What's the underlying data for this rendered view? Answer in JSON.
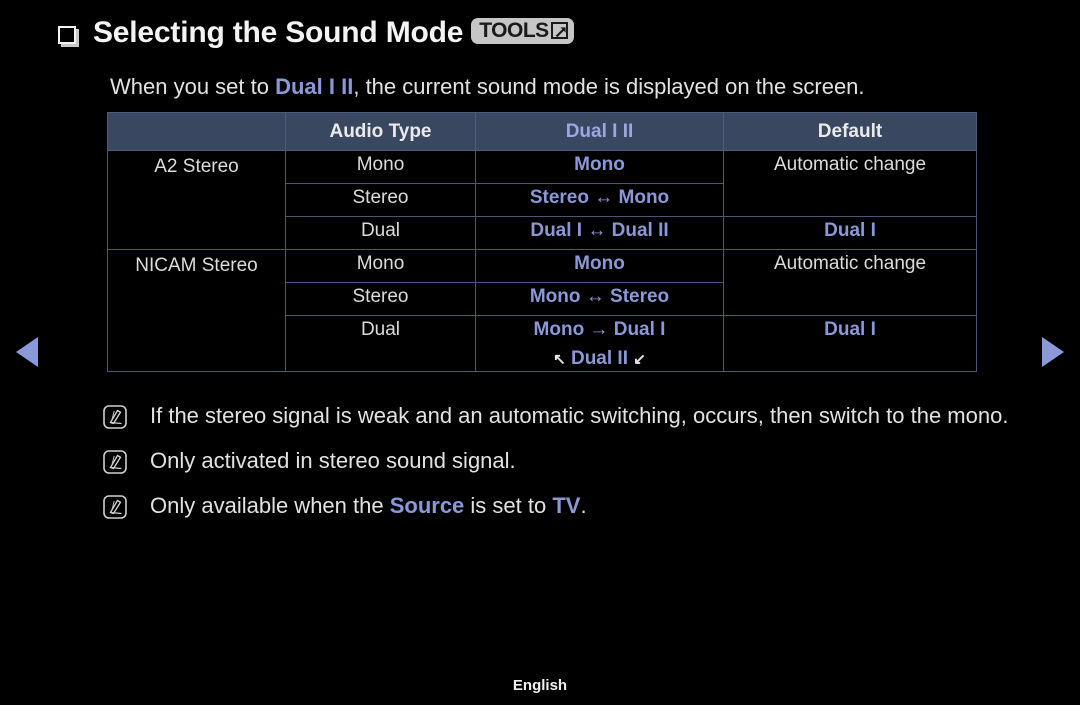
{
  "header": {
    "bullet_icon": "stacked-square-bullet",
    "title": "Selecting the Sound Mode",
    "tools_badge": {
      "label": "TOOLS",
      "icon": "external-link-arrow-icon"
    }
  },
  "subtitle": {
    "before": "When you set to ",
    "accent": "Dual I II",
    "after": ", the current sound mode is displayed on the screen."
  },
  "table": {
    "headers": [
      "",
      "Audio Type",
      "Dual I II",
      "Default"
    ],
    "rows": [
      {
        "signal": "A2 Stereo",
        "signal_rowspan": 3,
        "items": [
          {
            "audio_type": "Mono",
            "dual": "Mono",
            "default": "Automatic change",
            "default_rowspan": 2,
            "default_accent": false
          },
          {
            "audio_type": "Stereo",
            "dual": "Stereo ↔ Mono"
          },
          {
            "audio_type": "Dual",
            "dual": "Dual I ↔ Dual II",
            "default": "Dual I",
            "default_rowspan": 1,
            "default_accent": true
          }
        ]
      },
      {
        "signal": "NICAM Stereo",
        "signal_rowspan": 3,
        "items": [
          {
            "audio_type": "Mono",
            "dual": "Mono",
            "default": "Automatic change",
            "default_rowspan": 2,
            "default_accent": false
          },
          {
            "audio_type": "Stereo",
            "dual": "Mono ↔ Stereo"
          },
          {
            "audio_type": "Dual",
            "dual": "Mono → Dual I",
            "dual_line2_pre": "↖",
            "dual_line2": "Dual II",
            "dual_line2_post": "↙",
            "default": "Dual I",
            "default_rowspan": 1,
            "default_accent": true
          }
        ]
      }
    ]
  },
  "notes": [
    {
      "icon": "note-pen-icon",
      "text": "If the stereo signal is weak and an automatic switching, occurs, then switch to the mono."
    },
    {
      "icon": "note-pen-icon",
      "text": "Only activated in stereo sound signal."
    },
    {
      "icon": "note-pen-icon",
      "parts": [
        {
          "text": "Only available when the ",
          "accent": false
        },
        {
          "text": "Source",
          "accent": true
        },
        {
          "text": " is set to ",
          "accent": false
        },
        {
          "text": "TV",
          "accent": true
        },
        {
          "text": ".",
          "accent": false
        }
      ]
    }
  ],
  "nav": {
    "prev_label": "previous-page",
    "next_label": "next-page"
  },
  "footer": {
    "language": "English"
  },
  "colors": {
    "accent": "#8a98d8",
    "header_bg": "#3a4761",
    "border": "#49577a",
    "nav_arrow": "#8a9ad8",
    "badge_bg": "#c6c6c6"
  }
}
